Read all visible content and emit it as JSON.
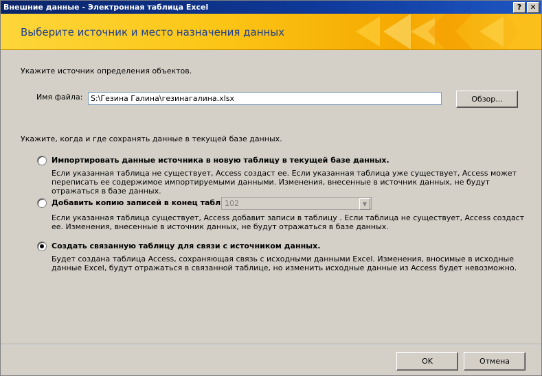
{
  "window": {
    "title": "Внешние данные - Электронная таблица Excel",
    "help_glyph": "?",
    "close_glyph": "✕"
  },
  "banner": {
    "heading": "Выберите источник и место назначения данных"
  },
  "source": {
    "prompt": "Укажите источник определения объектов.",
    "file_label": "Имя файла:",
    "file_value": "S:\\Гезина Галина\\гезинагалина.xlsx",
    "browse_label": "Обзор..."
  },
  "destination": {
    "prompt": "Укажите, когда и где сохранять данные в текущей базе данных.",
    "options": [
      {
        "label": "Импортировать данные источника в новую таблицу в текущей базе данных.",
        "description": "Если указанная таблица не существует, Access создаст ее. Если указанная таблица уже существует, Access может переписать ее содержимое импортируемыми данными. Изменения, внесенные в источник данных, не будут отражаться в базе данных.",
        "selected": false
      },
      {
        "label": "Добавить копию записей в конец таблицы:",
        "description": "Если указанная таблица существует, Access добавит записи в таблицу . Если таблица не существует, Access создаст ее. Изменения, внесенные в источник данных, не будут отражаться в базе данных.",
        "selected": false,
        "table_value": "102"
      },
      {
        "label": "Создать связанную таблицу для связи с источником данных.",
        "description": "Будет создана таблица Access, сохраняющая связь с исходными данными Excel. Изменения, вносимые в исходные данные Excel, будут отражаться в связанной таблице, но изменить исходные данные из Access будет невозможно.",
        "selected": true
      }
    ]
  },
  "footer": {
    "ok_label": "OK",
    "cancel_label": "Отмена"
  }
}
